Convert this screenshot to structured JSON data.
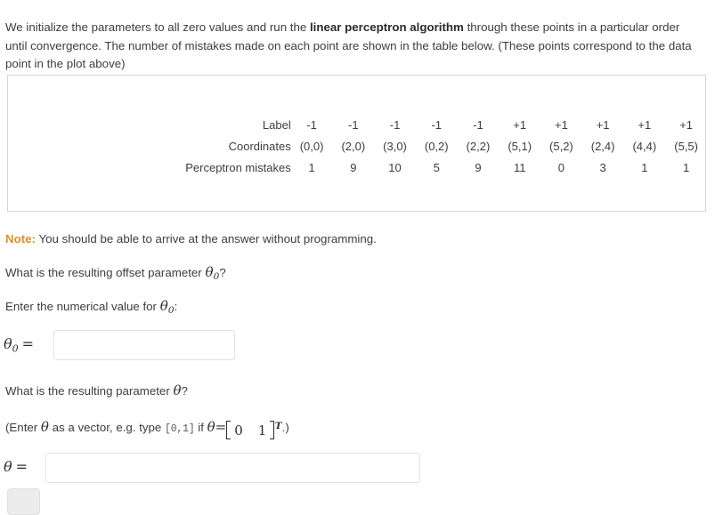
{
  "intro": {
    "part1": "We initialize the parameters to all zero values and run the ",
    "bold": "linear perceptron algorithm",
    "part2": " through these points in a particular order until convergence. The number of mistakes made on each point are shown in the table below. (These points correspond to the data point in the plot above)"
  },
  "table": {
    "row_labels": [
      "Label",
      "Coordinates",
      "Perceptron mistakes"
    ],
    "labels": [
      "-1",
      "-1",
      "-1",
      "-1",
      "-1",
      "+1",
      "+1",
      "+1",
      "+1",
      "+1"
    ],
    "coordinates": [
      "(0,0)",
      "(2,0)",
      "(3,0)",
      "(0,2)",
      "(2,2)",
      "(5,1)",
      "(5,2)",
      "(2,4)",
      "(4,4)",
      "(5,5)"
    ],
    "mistakes": [
      "1",
      "9",
      "10",
      "5",
      "9",
      "11",
      "0",
      "3",
      "1",
      "1"
    ]
  },
  "note": {
    "keyword": "Note:",
    "text": " You should be able to arrive at the answer without programming."
  },
  "questions": {
    "offset_q_pre": "What is the resulting offset parameter ",
    "offset_q_theta": "θ",
    "offset_q_sub": "0",
    "offset_q_post": "?",
    "enter_num_pre": "Enter the numerical value for ",
    "enter_num_theta": "θ",
    "enter_num_sub": "0",
    "enter_num_post": ":",
    "param_q_pre": "What is the resulting parameter ",
    "param_q_theta": "θ",
    "param_q_post": "?",
    "hint_pre": "(Enter ",
    "hint_theta": "θ",
    "hint_mid": " as a vector, e.g. type ",
    "hint_mono": "[0,1]",
    "hint_if": " if ",
    "hint_theta2": "θ",
    "hint_eq": "=",
    "hint_m0": "0",
    "hint_m1": "1",
    "hint_T": "T",
    "hint_end": ".)"
  },
  "answers": {
    "theta0_symbol": "θ",
    "theta0_sub": "0",
    "theta0_eq": "=",
    "theta0_value": "",
    "theta0_placeholder": "",
    "theta_symbol": "θ",
    "theta_eq": "=",
    "theta_value": "",
    "theta_placeholder": "",
    "submit_label": ""
  },
  "colors": {
    "note_accent": "#e08b2d",
    "text": "#3d3d3d",
    "border": "#d6d6d6",
    "input_border": "#e2e2e2",
    "button_bg": "#ececec"
  }
}
